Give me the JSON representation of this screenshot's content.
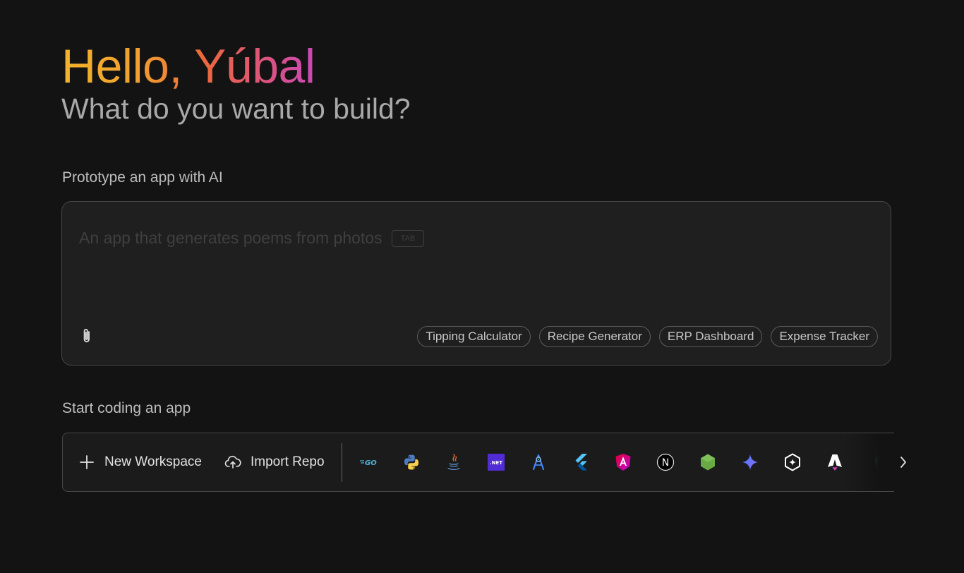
{
  "header": {
    "greeting": "Hello, Yúbal",
    "subtitle": "What do you want to build?"
  },
  "prototype": {
    "label": "Prototype an app with AI",
    "placeholder": "An app that generates poems from photos",
    "tab_hint": "TAB",
    "suggestions": [
      "Tipping Calculator",
      "Recipe Generator",
      "ERP Dashboard",
      "Expense Tracker"
    ]
  },
  "coding": {
    "label": "Start coding an app",
    "new_workspace": "New Workspace",
    "import_repo": "Import Repo",
    "frameworks": [
      {
        "name": "go",
        "icon": "go-icon",
        "text": "GO"
      },
      {
        "name": "python",
        "icon": "python-icon"
      },
      {
        "name": "java",
        "icon": "java-icon"
      },
      {
        "name": "dotnet",
        "icon": "dotnet-icon",
        "text": ".NET"
      },
      {
        "name": "android-studio",
        "icon": "android-studio-icon"
      },
      {
        "name": "flutter",
        "icon": "flutter-icon"
      },
      {
        "name": "angular",
        "icon": "angular-icon"
      },
      {
        "name": "nextjs",
        "icon": "nextjs-icon",
        "text": "N"
      },
      {
        "name": "nodejs",
        "icon": "nodejs-icon"
      },
      {
        "name": "gemini",
        "icon": "gemini-sparkle-icon"
      },
      {
        "name": "hexagon-framework",
        "icon": "hexagon-icon"
      },
      {
        "name": "astro",
        "icon": "astro-icon"
      },
      {
        "name": "mongodb",
        "icon": "mongodb-leaf-icon"
      }
    ]
  },
  "colors": {
    "background": "#131314",
    "box": "#1f1f20",
    "border": "#444746",
    "gradient_start": "#f4b32b",
    "gradient_end": "#c94ab5"
  }
}
